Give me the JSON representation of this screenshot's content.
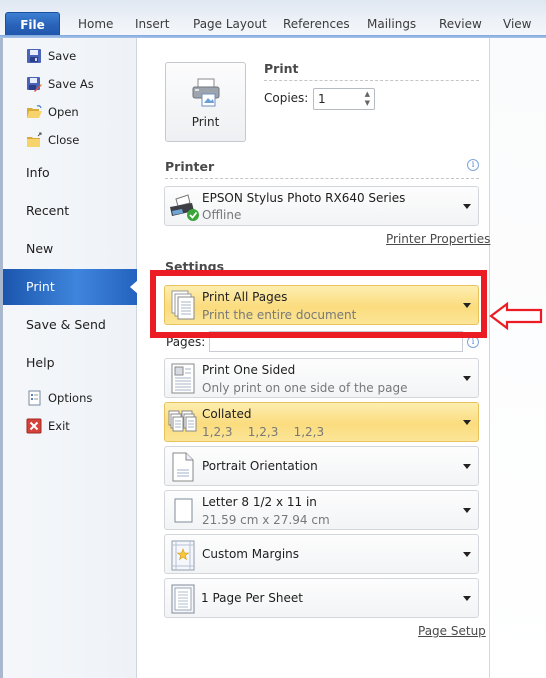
{
  "ribbon": {
    "tabs": [
      {
        "label": "File",
        "active": true
      },
      {
        "label": "Home"
      },
      {
        "label": "Insert"
      },
      {
        "label": "Page Layout"
      },
      {
        "label": "References"
      },
      {
        "label": "Mailings"
      },
      {
        "label": "Review"
      },
      {
        "label": "View"
      }
    ]
  },
  "backstage_nav": {
    "small_items": [
      {
        "label": "Save",
        "icon": "save-icon"
      },
      {
        "label": "Save As",
        "icon": "save-as-icon"
      },
      {
        "label": "Open",
        "icon": "open-folder-icon"
      },
      {
        "label": "Close",
        "icon": "close-folder-icon"
      }
    ],
    "big_items": [
      {
        "label": "Info"
      },
      {
        "label": "Recent"
      },
      {
        "label": "New"
      },
      {
        "label": "Print",
        "active": true
      },
      {
        "label": "Save & Send"
      },
      {
        "label": "Help"
      }
    ],
    "bottom_items": [
      {
        "label": "Options",
        "icon": "options-icon"
      },
      {
        "label": "Exit",
        "icon": "exit-icon"
      }
    ]
  },
  "print": {
    "button_label": "Print",
    "section_title": "Print",
    "copies_label": "Copies:",
    "copies_value": "1"
  },
  "printer": {
    "section_title": "Printer",
    "name": "EPSON Stylus Photo RX640 Series",
    "status": "Offline",
    "properties_link": "Printer Properties"
  },
  "settings": {
    "section_title": "Settings",
    "pages_label": "Pages:",
    "pages_value": "",
    "options": [
      {
        "title": "Print All Pages",
        "subtitle": "Print the entire document",
        "highlighted": true
      },
      {
        "title": "Print One Sided",
        "subtitle": "Only print on one side of the page"
      },
      {
        "title": "Collated",
        "subtitle": "1,2,3    1,2,3    1,2,3",
        "highlighted": true
      },
      {
        "title": "Portrait Orientation"
      },
      {
        "title": "Letter 8 1/2 x 11 in",
        "subtitle": "21.59 cm x 27.94 cm"
      },
      {
        "title": "Custom Margins"
      },
      {
        "title": "1 Page Per Sheet"
      }
    ],
    "page_setup_link": "Page Setup"
  },
  "annotation": {
    "highlight_color": "#ec1c24"
  }
}
